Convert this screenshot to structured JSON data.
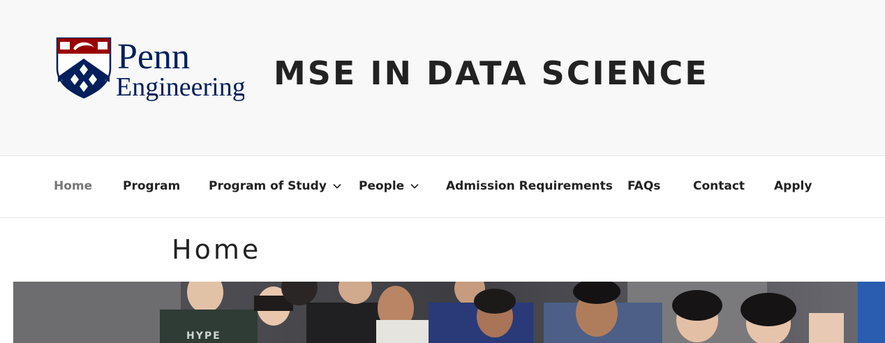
{
  "logo": {
    "wordmark_line1": "Penn",
    "wordmark_line2": "Engineering",
    "brand_blue": "#011f5b",
    "brand_red": "#990000"
  },
  "site": {
    "title": "MSE IN DATA SCIENCE"
  },
  "nav": {
    "items": [
      {
        "label": "Home",
        "active": true,
        "dropdown": false
      },
      {
        "label": "Program",
        "active": false,
        "dropdown": false
      },
      {
        "label": "Program of Study",
        "active": false,
        "dropdown": true
      },
      {
        "label": "People",
        "active": false,
        "dropdown": true
      },
      {
        "label": "Admission Requirements",
        "active": false,
        "dropdown": false
      },
      {
        "label": "FAQs",
        "active": false,
        "dropdown": false
      },
      {
        "label": "Contact",
        "active": false,
        "dropdown": false
      },
      {
        "label": "Apply",
        "active": false,
        "dropdown": false
      }
    ]
  },
  "page": {
    "title": "Home"
  },
  "hero": {
    "shirt_text": "HYPE"
  }
}
